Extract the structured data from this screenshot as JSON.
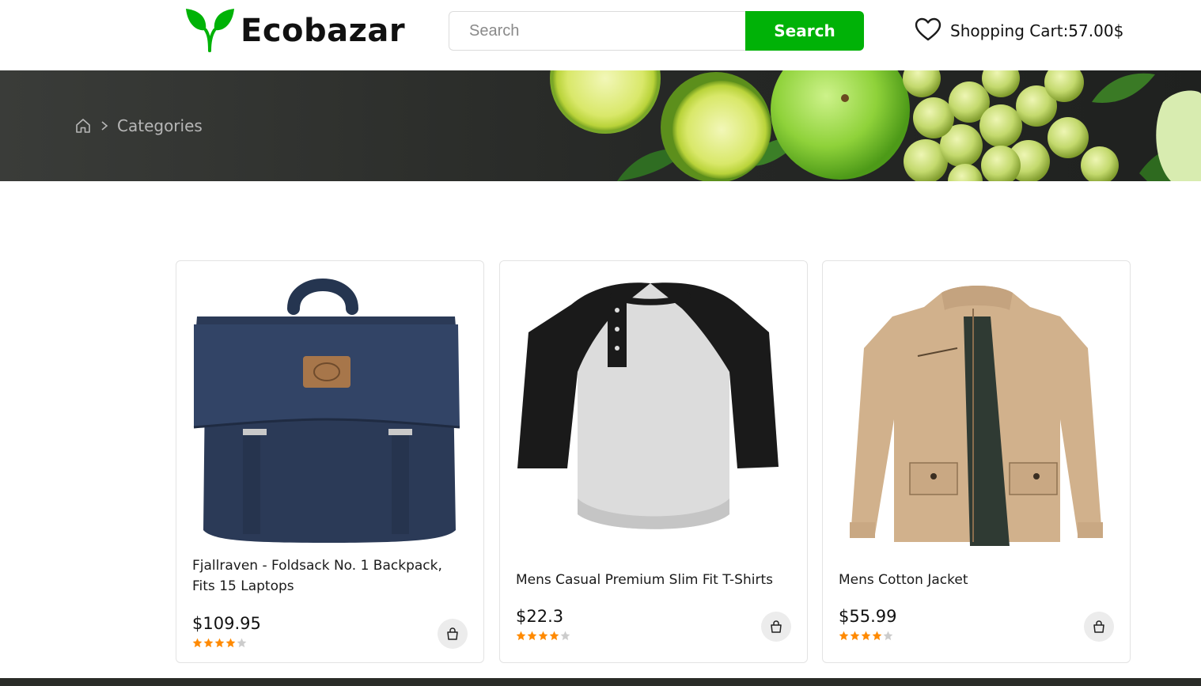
{
  "header": {
    "logo_text": "Ecobazar",
    "search": {
      "placeholder": "Search",
      "value": "",
      "button_label": "Search"
    },
    "cart_label": "Shopping Cart:57.00$"
  },
  "banner": {
    "breadcrumb": {
      "current": "Categories"
    }
  },
  "products": [
    {
      "title": "Fjallraven - Foldsack No. 1 Backpack, Fits 15 Laptops",
      "price": "$109.95",
      "rating": 4,
      "max_rating": 5
    },
    {
      "title": "Mens Casual Premium Slim Fit T-Shirts",
      "price": "$22.3",
      "rating": 4,
      "max_rating": 5
    },
    {
      "title": "Mens Cotton Jacket",
      "price": "$55.99",
      "rating": 4,
      "max_rating": 5
    }
  ],
  "icons": {
    "logo": "leaf-sprout-icon",
    "cart": "heart-icon",
    "home": "home-icon",
    "separator": "chevron-right-icon",
    "add_to_cart": "shopping-bag-icon",
    "rating": "star-icon"
  },
  "colors": {
    "brand": "#00b207",
    "star_filled": "#ff8a00",
    "star_empty": "#cccccc"
  }
}
